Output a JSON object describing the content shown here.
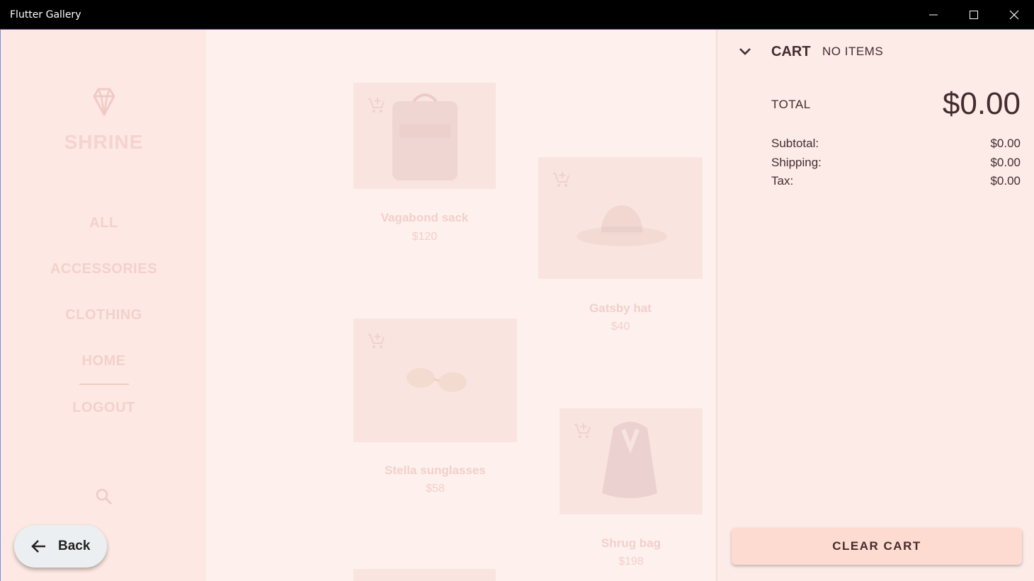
{
  "window": {
    "title": "Flutter Gallery"
  },
  "sidebar": {
    "brand": "SHRINE",
    "nav": [
      "ALL",
      "ACCESSORIES",
      "CLOTHING",
      "HOME",
      "LOGOUT"
    ]
  },
  "products": [
    {
      "name": "Vagabond sack",
      "price": "$120"
    },
    {
      "name": "Gatsby hat",
      "price": "$40"
    },
    {
      "name": "Stella sunglasses",
      "price": "$58"
    },
    {
      "name": "Shrug bag",
      "price": "$198"
    }
  ],
  "cart": {
    "title": "CART",
    "count": "NO ITEMS",
    "total_label": "TOTAL",
    "total_value": "$0.00",
    "subtotal_label": "Subtotal:",
    "subtotal_value": "$0.00",
    "shipping_label": "Shipping:",
    "shipping_value": "$0.00",
    "tax_label": "Tax:",
    "tax_value": "$0.00",
    "clear_label": "CLEAR CART"
  },
  "back": {
    "label": "Back"
  },
  "colors": {
    "text_dark": "#442c2e",
    "button_bg": "#fedbd0",
    "faded_text": "#f1d0cb"
  }
}
